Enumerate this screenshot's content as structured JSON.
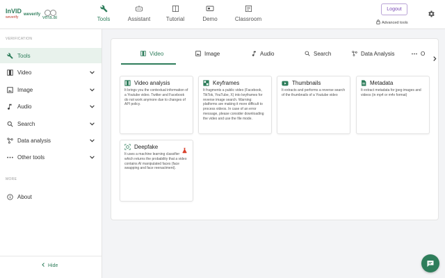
{
  "brand": {
    "invid": "InVID",
    "invid_sub": "weverify",
    "wevrify": "weverify",
    "vera": "vera.ai"
  },
  "topnav": [
    {
      "label": "Tools",
      "icon": "wrench-icon",
      "active": true
    },
    {
      "label": "Assistant",
      "icon": "robot-icon",
      "active": false
    },
    {
      "label": "Tutorial",
      "icon": "book-icon",
      "active": false
    },
    {
      "label": "Demo",
      "icon": "video-camera-icon",
      "active": false
    },
    {
      "label": "Classroom",
      "icon": "classroom-icon",
      "active": false
    }
  ],
  "header": {
    "logout_label": "Logout",
    "advanced_tools_label": "Advanced tools"
  },
  "sidebar": {
    "section_verification": "VERIFICATION",
    "section_more": "MORE",
    "items": [
      {
        "label": "Tools",
        "icon": "wrench-icon"
      },
      {
        "label": "Video",
        "icon": "film-icon"
      },
      {
        "label": "Image",
        "icon": "image-icon"
      },
      {
        "label": "Audio",
        "icon": "music-note-icon"
      },
      {
        "label": "Search",
        "icon": "search-icon"
      },
      {
        "label": "Data analysis",
        "icon": "graph-icon"
      },
      {
        "label": "Other tools",
        "icon": "more-dots-icon"
      },
      {
        "label": "About",
        "icon": "info-icon"
      }
    ],
    "hide_label": "Hide"
  },
  "tabs": [
    {
      "label": "Video",
      "icon": "film-icon"
    },
    {
      "label": "Image",
      "icon": "image-icon"
    },
    {
      "label": "Audio",
      "icon": "music-note-icon"
    },
    {
      "label": "Search",
      "icon": "search-icon"
    },
    {
      "label": "Data Analysis",
      "icon": "graph-icon"
    },
    {
      "label": "O",
      "icon": "more-dots-icon"
    }
  ],
  "tools": [
    {
      "title": "Video analysis",
      "desc": "It brings you the contextual information of a Youtube video. Twitter and Facebook do not work anymore due to changes of API policy."
    },
    {
      "title": "Keyframes",
      "desc": "It fragments a public video (Facebook, TikTok, YouTube, X) into keyframes for reverse image search. Warning: platforms are making it more difficult to process videos. In case of an error message, please consider downloading the video and use the file mode."
    },
    {
      "title": "Thumbnails",
      "desc": "It extracts and performs a reverse search of the thumbnails of a Youtube video"
    },
    {
      "title": "Metadata",
      "desc": "It extract metadata for jpeg images and videos (in mp4 or m4v format)"
    },
    {
      "title": "Deepfake",
      "desc": "It uses a machine learning classifier which returns the probability that a video contains AI manipulated faces (face swapping and face reenactment)."
    }
  ],
  "colors": {
    "accent": "#2e7d5b",
    "logout": "#7a4bb5",
    "experimental": "#d9412c"
  }
}
